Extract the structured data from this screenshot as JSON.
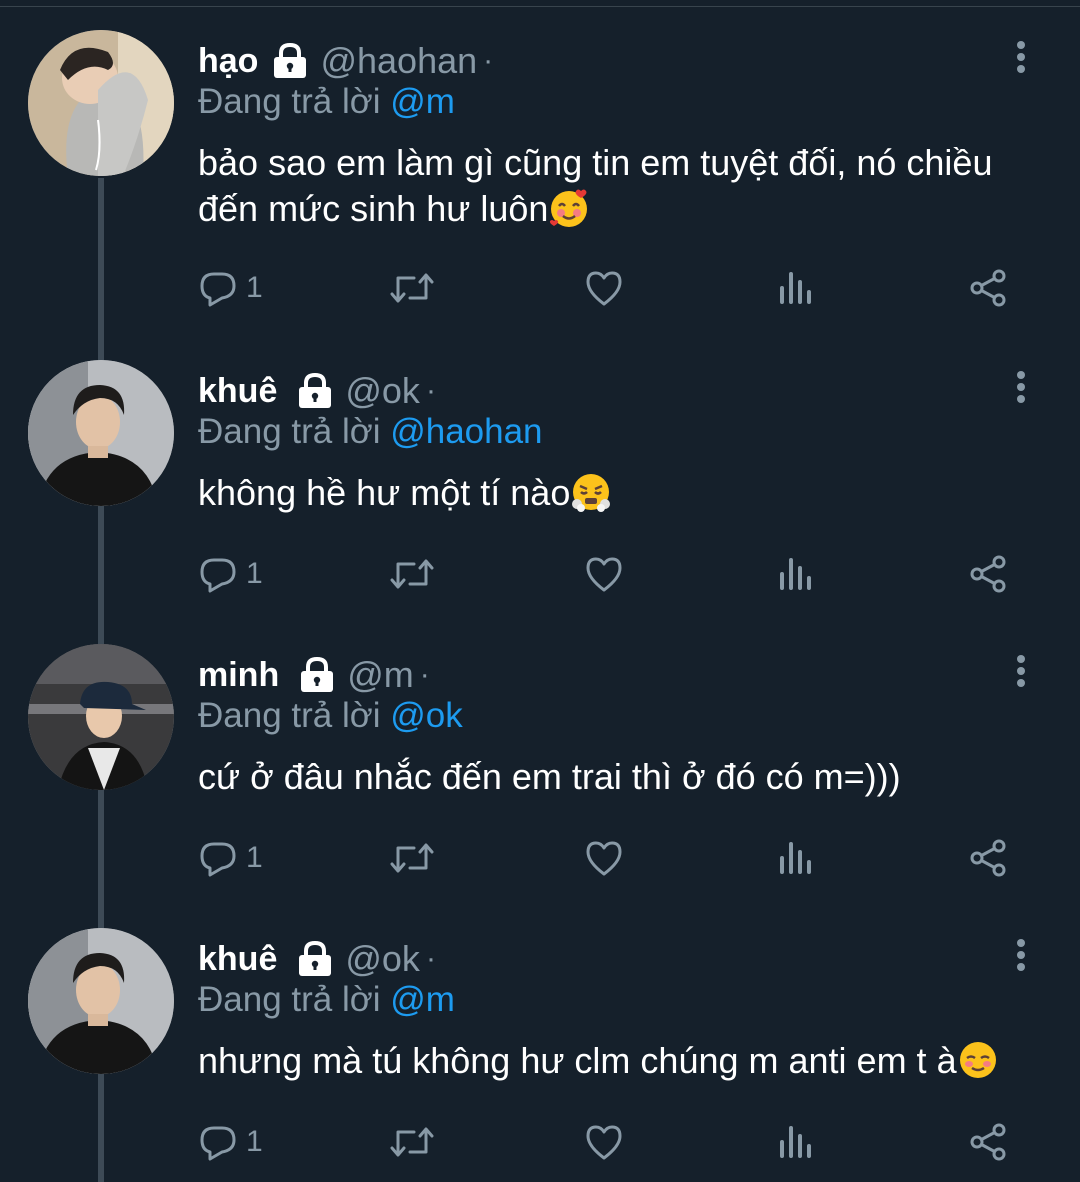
{
  "tweets": [
    {
      "name": "hạo",
      "handle": "@haohan",
      "separator": "·",
      "replying_label": "Đang trả lời ",
      "replying_to": "@m",
      "text": "bảo sao em làm gì cũng tin em tuyệt đối, nó chiều đến mức sinh hư luôn",
      "emoji": "smiling-face-with-hearts",
      "reply_count": "1"
    },
    {
      "name": "khuê",
      "handle": "@ok",
      "separator": "·",
      "replying_label": "Đang trả lời ",
      "replying_to": "@haohan",
      "text": "không hề hư một tí nào",
      "emoji": "face-with-steam",
      "reply_count": "1"
    },
    {
      "name": "minh",
      "handle": "@m",
      "separator": "·",
      "replying_label": "Đang trả lời ",
      "replying_to": "@ok",
      "text": "cứ ở đâu nhắc đến em trai thì ở đó có m=)))",
      "emoji": "",
      "reply_count": "1"
    },
    {
      "name": "khuê",
      "handle": "@ok",
      "separator": "·",
      "replying_label": "Đang trả lời ",
      "replying_to": "@m",
      "text": "nhưng mà tú không hư clm chúng m anti em t à",
      "emoji": "smiling-face-blush",
      "reply_count": "1"
    }
  ],
  "icons": [
    "lock-icon",
    "more-icon",
    "reply-icon",
    "retweet-icon",
    "like-icon",
    "views-icon",
    "share-icon"
  ],
  "colors": {
    "background": "#15202b",
    "text_primary": "#ffffff",
    "text_secondary": "#8899a6",
    "mention": "#1d9bf0",
    "thread_line": "#3d4a56"
  }
}
